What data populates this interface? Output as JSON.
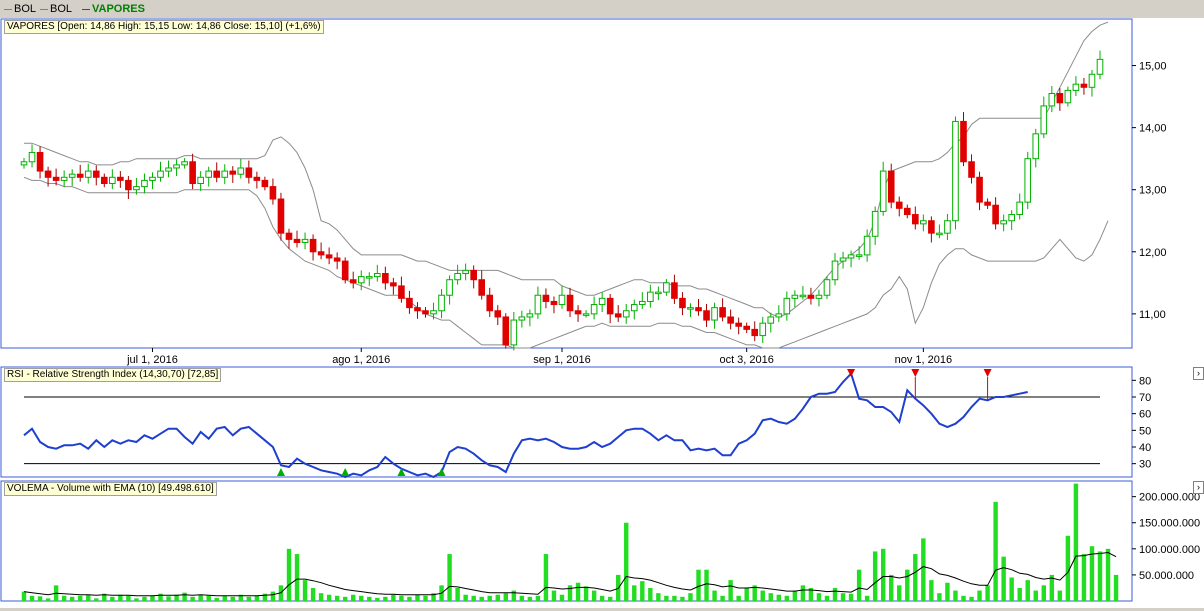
{
  "legend": [
    {
      "label": "BOL",
      "color": "#808080",
      "bold": false
    },
    {
      "label": "BOL",
      "color": "#808080",
      "bold": false
    },
    {
      "label": "VAPORES",
      "color": "#008000",
      "bold": true
    }
  ],
  "price_panel": {
    "label": "VAPORES [Open: 14,86  High: 15,15  Low: 14,86  Close: 15,10] (+1,6%)"
  },
  "rsi_panel": {
    "label": "RSI - Relative Strength Index (14,30,70) [72,85]"
  },
  "volume_panel": {
    "label": "VOLEMA - Volume with EMA (10) [49.498.610]"
  },
  "colors": {
    "up": "#00b000",
    "down": "#e00000",
    "bands": "#8c8c8c",
    "rsi_line": "#1f3fcf",
    "volume_bar": "#22dd22",
    "ema_line": "#000000",
    "frame": "#3a5fd9"
  },
  "chart_data": [
    {
      "type": "candlestick",
      "x_ticks": [
        "jul 1, 2016",
        "ago 1, 2016",
        "sep 1, 2016",
        "oct 3, 2016",
        "nov 1, 2016"
      ],
      "x_tick_index": [
        16,
        42,
        67,
        90,
        112
      ],
      "y_ticks": [
        "11,00",
        "12,00",
        "13,00",
        "14,00",
        "15,00"
      ],
      "y_tick_values": [
        11,
        12,
        13,
        14,
        15
      ],
      "ylim": [
        10.45,
        15.75
      ],
      "close": [
        13.45,
        13.6,
        13.3,
        13.2,
        13.15,
        13.2,
        13.25,
        13.2,
        13.3,
        13.2,
        13.1,
        13.2,
        13.15,
        13.0,
        13.05,
        13.15,
        13.2,
        13.3,
        13.35,
        13.4,
        13.45,
        13.1,
        13.2,
        13.3,
        13.2,
        13.3,
        13.25,
        13.35,
        13.2,
        13.15,
        13.05,
        12.85,
        12.3,
        12.2,
        12.15,
        12.2,
        12.0,
        11.95,
        11.9,
        11.85,
        11.55,
        11.5,
        11.6,
        11.6,
        11.65,
        11.5,
        11.45,
        11.25,
        11.1,
        11.05,
        11.0,
        11.05,
        11.3,
        11.55,
        11.65,
        11.7,
        11.55,
        11.3,
        11.05,
        10.95,
        10.5,
        10.9,
        10.95,
        11.0,
        11.3,
        11.2,
        11.15,
        11.3,
        11.05,
        11.0,
        11.0,
        11.15,
        11.25,
        11.0,
        10.95,
        11.05,
        11.15,
        11.2,
        11.35,
        11.35,
        11.5,
        11.25,
        11.1,
        11.1,
        11.05,
        10.9,
        11.1,
        10.95,
        10.85,
        10.8,
        10.75,
        10.65,
        10.85,
        10.95,
        11.0,
        11.25,
        11.3,
        11.3,
        11.25,
        11.3,
        11.55,
        11.85,
        11.9,
        11.95,
        11.95,
        12.25,
        12.65,
        13.3,
        12.8,
        12.7,
        12.6,
        12.45,
        12.5,
        12.3,
        12.3,
        12.5,
        14.1,
        13.45,
        13.2,
        12.8,
        12.75,
        12.45,
        12.5,
        12.6,
        12.8,
        13.5,
        13.9,
        14.35,
        14.55,
        14.4,
        14.6,
        14.7,
        14.65,
        14.86,
        15.1
      ],
      "bands_upper": [
        13.75,
        13.75,
        13.7,
        13.65,
        13.6,
        13.55,
        13.5,
        13.45,
        13.45,
        13.4,
        13.4,
        13.4,
        13.45,
        13.45,
        13.5,
        13.5,
        13.5,
        13.5,
        13.5,
        13.5,
        13.55,
        13.55,
        13.5,
        13.5,
        13.5,
        13.5,
        13.5,
        13.5,
        13.5,
        13.5,
        13.55,
        13.8,
        13.85,
        13.75,
        13.6,
        13.35,
        13.0,
        12.5,
        12.45,
        12.35,
        12.2,
        12.05,
        11.95,
        11.95,
        11.95,
        11.95,
        11.95,
        11.95,
        11.9,
        11.85,
        11.85,
        11.8,
        11.75,
        11.7,
        11.7,
        11.7,
        11.7,
        11.7,
        11.7,
        11.7,
        11.65,
        11.6,
        11.55,
        11.55,
        11.55,
        11.55,
        11.55,
        11.45,
        11.4,
        11.35,
        11.3,
        11.3,
        11.35,
        11.4,
        11.45,
        11.5,
        11.55,
        11.55,
        11.5,
        11.5,
        11.5,
        11.45,
        11.45,
        11.45,
        11.4,
        11.4,
        11.35,
        11.3,
        11.25,
        11.2,
        11.15,
        11.1,
        11.1,
        11.0,
        10.95,
        11.0,
        11.1,
        11.2,
        11.3,
        11.45,
        11.6,
        11.75,
        11.85,
        11.95,
        12.05,
        12.2,
        12.5,
        13.0,
        13.3,
        13.35,
        13.4,
        13.45,
        13.45,
        13.45,
        13.5,
        13.6,
        13.75,
        13.85,
        14.05,
        14.15,
        14.15,
        14.15,
        14.15,
        14.15,
        14.15,
        14.15,
        14.15,
        14.15,
        14.4,
        14.65,
        14.9,
        15.15,
        15.4,
        15.55,
        15.65,
        15.7
      ],
      "bands_lower": [
        13.2,
        13.15,
        13.15,
        13.1,
        13.1,
        13.05,
        13.05,
        13.0,
        12.95,
        12.95,
        12.95,
        12.95,
        12.95,
        12.95,
        12.95,
        12.95,
        12.95,
        12.95,
        12.95,
        12.95,
        13.0,
        13.0,
        13.0,
        13.0,
        13.0,
        13.0,
        13.0,
        13.0,
        13.0,
        12.9,
        12.7,
        12.4,
        12.2,
        12.05,
        11.95,
        11.85,
        11.8,
        11.75,
        11.7,
        11.6,
        11.55,
        11.5,
        11.45,
        11.4,
        11.35,
        11.3,
        11.3,
        11.3,
        11.2,
        11.1,
        11.0,
        10.95,
        10.9,
        10.9,
        10.8,
        10.7,
        10.6,
        10.5,
        10.5,
        10.5,
        10.5,
        10.45,
        10.45,
        10.45,
        10.5,
        10.55,
        10.6,
        10.65,
        10.7,
        10.75,
        10.8,
        10.8,
        10.85,
        10.8,
        10.8,
        10.8,
        10.8,
        10.8,
        10.8,
        10.85,
        10.85,
        10.85,
        10.8,
        10.8,
        10.75,
        10.7,
        10.7,
        10.65,
        10.6,
        10.55,
        10.5,
        10.5,
        10.45,
        10.45,
        10.45,
        10.5,
        10.55,
        10.6,
        10.65,
        10.7,
        10.75,
        10.8,
        10.85,
        10.9,
        10.95,
        11.0,
        11.1,
        11.3,
        11.4,
        11.6,
        11.4,
        10.85,
        11.1,
        11.5,
        11.8,
        11.95,
        12.05,
        12.05,
        11.95,
        11.9,
        11.85,
        11.85,
        11.85,
        11.85,
        11.85,
        11.85,
        11.85,
        11.9,
        12.05,
        12.2,
        12.05,
        11.9,
        11.85,
        11.95,
        12.2,
        12.5
      ]
    },
    {
      "type": "line",
      "name": "RSI",
      "y_ticks": [
        "30",
        "40",
        "50",
        "60",
        "70",
        "80"
      ],
      "y_tick_values": [
        30,
        40,
        50,
        60,
        70,
        80
      ],
      "ylim": [
        22,
        88
      ],
      "thresholds": [
        30,
        70
      ],
      "values": [
        47,
        51,
        43,
        40,
        39,
        41,
        41,
        42,
        39,
        44,
        40,
        44,
        42,
        44,
        43,
        47,
        45,
        48,
        51,
        51,
        46,
        42,
        49,
        45,
        51,
        52,
        47,
        51,
        52,
        48,
        44,
        40,
        29,
        28,
        33,
        30,
        28,
        26,
        25,
        24,
        22,
        24,
        23,
        26,
        28,
        34,
        30,
        27,
        25,
        23,
        24,
        22,
        25,
        37,
        40,
        39,
        36,
        32,
        29,
        28,
        25,
        36,
        44,
        45,
        44,
        45,
        43,
        40,
        39,
        39,
        40,
        43,
        40,
        42,
        46,
        50,
        51,
        51,
        48,
        44,
        47,
        44,
        44,
        38,
        39,
        38,
        39,
        35,
        35,
        42,
        44,
        48,
        56,
        57,
        55,
        54,
        57,
        63,
        70,
        72,
        72,
        73,
        79,
        84,
        69,
        68,
        64,
        64,
        61,
        55,
        74,
        69,
        65,
        60,
        54,
        52,
        54,
        58,
        64,
        69,
        68,
        70,
        70,
        71,
        72,
        73
      ],
      "sell_signal_index": [
        103,
        111,
        120
      ],
      "buy_signal_index": [
        32,
        40,
        47,
        52
      ]
    },
    {
      "type": "bar",
      "name": "Volume",
      "y_ticks": [
        "50.000.000",
        "100.000.000",
        "150.000.000",
        "200.000.000"
      ],
      "y_tick_values": [
        50000000,
        100000000,
        150000000,
        200000000
      ],
      "ylim": [
        0,
        230000000
      ],
      "volume_millions": [
        18,
        10,
        9,
        5,
        30,
        10,
        8,
        10,
        12,
        5,
        14,
        8,
        12,
        10,
        5,
        8,
        10,
        14,
        9,
        12,
        16,
        8,
        12,
        10,
        6,
        10,
        8,
        12,
        8,
        10,
        14,
        18,
        30,
        100,
        90,
        40,
        25,
        15,
        12,
        10,
        8,
        12,
        10,
        8,
        6,
        8,
        12,
        10,
        8,
        12,
        10,
        15,
        30,
        90,
        25,
        12,
        10,
        8,
        10,
        12,
        15,
        20,
        10,
        8,
        10,
        90,
        20,
        12,
        30,
        35,
        28,
        20,
        10,
        8,
        50,
        150,
        30,
        38,
        25,
        15,
        10,
        10,
        8,
        15,
        60,
        60,
        20,
        10,
        40,
        10,
        25,
        30,
        20,
        15,
        12,
        10,
        20,
        30,
        25,
        15,
        10,
        25,
        15,
        14,
        60,
        10,
        95,
        100,
        50,
        30,
        60,
        90,
        120,
        40,
        15,
        35,
        20,
        10,
        8,
        20,
        30,
        190,
        85,
        45,
        25,
        40,
        20,
        30,
        50,
        20,
        125,
        225,
        90,
        105,
        95,
        100,
        50
      ],
      "ema_millions": [
        18,
        16,
        14,
        12,
        15,
        14,
        13,
        12,
        12,
        11,
        12,
        11,
        11,
        11,
        10,
        10,
        10,
        11,
        11,
        11,
        12,
        11,
        12,
        11,
        10,
        10,
        10,
        10,
        10,
        10,
        11,
        12,
        16,
        31,
        42,
        42,
        39,
        35,
        30,
        26,
        22,
        20,
        18,
        16,
        14,
        13,
        13,
        12,
        12,
        12,
        12,
        12,
        15,
        28,
        27,
        24,
        21,
        18,
        16,
        16,
        16,
        16,
        15,
        14,
        13,
        26,
        25,
        23,
        24,
        26,
        26,
        25,
        22,
        19,
        24,
        47,
        44,
        43,
        40,
        35,
        30,
        26,
        23,
        21,
        28,
        33,
        31,
        27,
        29,
        25,
        25,
        26,
        25,
        23,
        21,
        19,
        19,
        21,
        21,
        20,
        18,
        19,
        18,
        17,
        25,
        22,
        35,
        47,
        47,
        44,
        47,
        55,
        66,
        62,
        52,
        49,
        44,
        38,
        33,
        30,
        30,
        59,
        64,
        60,
        53,
        51,
        45,
        42,
        44,
        40,
        55,
        86,
        87,
        90,
        91,
        93,
        85
      ]
    }
  ]
}
